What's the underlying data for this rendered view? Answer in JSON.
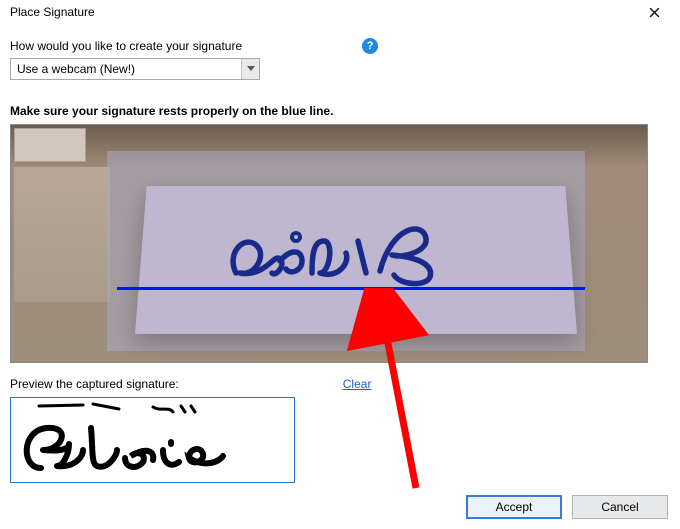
{
  "dialog": {
    "title": "Place Signature"
  },
  "method": {
    "label": "How would you like to create your signature",
    "selected": "Use a webcam (New!)"
  },
  "instruction": "Make sure your signature rests properly on the blue line.",
  "preview": {
    "label": "Preview the captured signature:",
    "clear": "Clear"
  },
  "buttons": {
    "accept": "Accept",
    "cancel": "Cancel"
  }
}
